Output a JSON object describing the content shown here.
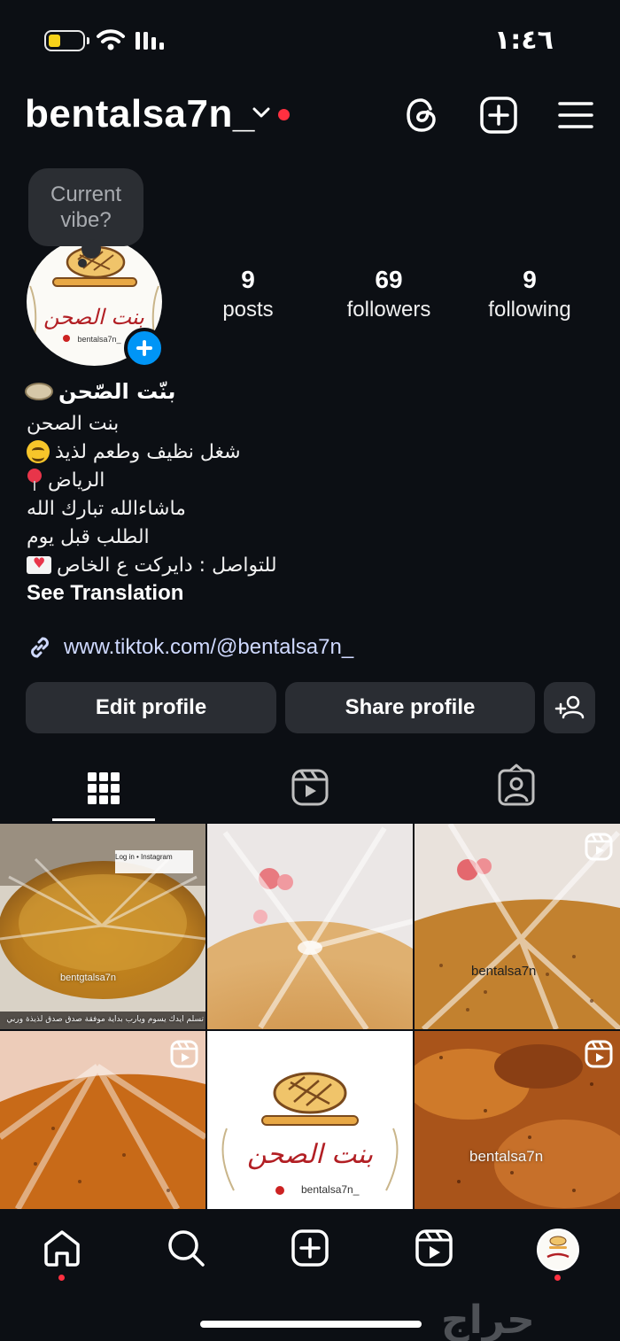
{
  "status_bar": {
    "time": "١:٤٦",
    "battery_level": 0.35,
    "battery_color": "#f6d21a",
    "icons": [
      "battery-icon",
      "wifi-icon",
      "cellular-signal-icon"
    ]
  },
  "header": {
    "username": "bentalsa7n_",
    "notification_dot_color": "#ff3040",
    "icons": [
      "chevron-down-icon",
      "threads-icon",
      "create-post-icon",
      "menu-icon"
    ]
  },
  "note_bubble": {
    "text": "Current vibe?"
  },
  "avatar_logo": {
    "text_ar": "بنت الصحن",
    "handle": "bentalsa7n_"
  },
  "stats": [
    {
      "value": "9",
      "label": "posts"
    },
    {
      "value": "69",
      "label": "followers"
    },
    {
      "value": "9",
      "label": "following"
    }
  ],
  "bio": {
    "display_name": "بنّت الصّحن",
    "lines": [
      "بنت الصحن",
      "شغل نظيف وطعم لذيذ",
      "الرياض",
      "ماشاءالله تبارك الله",
      "الطلب قبل يوم",
      "للتواصل : دايركت ع الخاص"
    ],
    "see_translation": "See Translation",
    "link": "www.tiktok.com/@bentalsa7n_"
  },
  "actions": {
    "edit_profile": "Edit profile",
    "share_profile": "Share profile"
  },
  "tabs": [
    "posts-grid-tab",
    "reels-tab",
    "tagged-tab"
  ],
  "grid": {
    "cell1_caption": "تسلم ايدك يسوم ويارب بداية موفقة صدق صدق لذيذة وربي",
    "cell1_watermark": "bentgtalsa7n",
    "cell1_login": "Log in • Instagram",
    "cell3_watermark": "bentalsa7n",
    "cell5_logo_ar": "بنت الصحن",
    "cell5_handle": "bentalsa7n_",
    "cell6_watermark": "bentalsa7n"
  },
  "bottom_nav": {
    "items": [
      "home-icon",
      "search-icon",
      "create-icon",
      "reels-icon",
      "profile-avatar"
    ],
    "watermark": "حراج"
  }
}
